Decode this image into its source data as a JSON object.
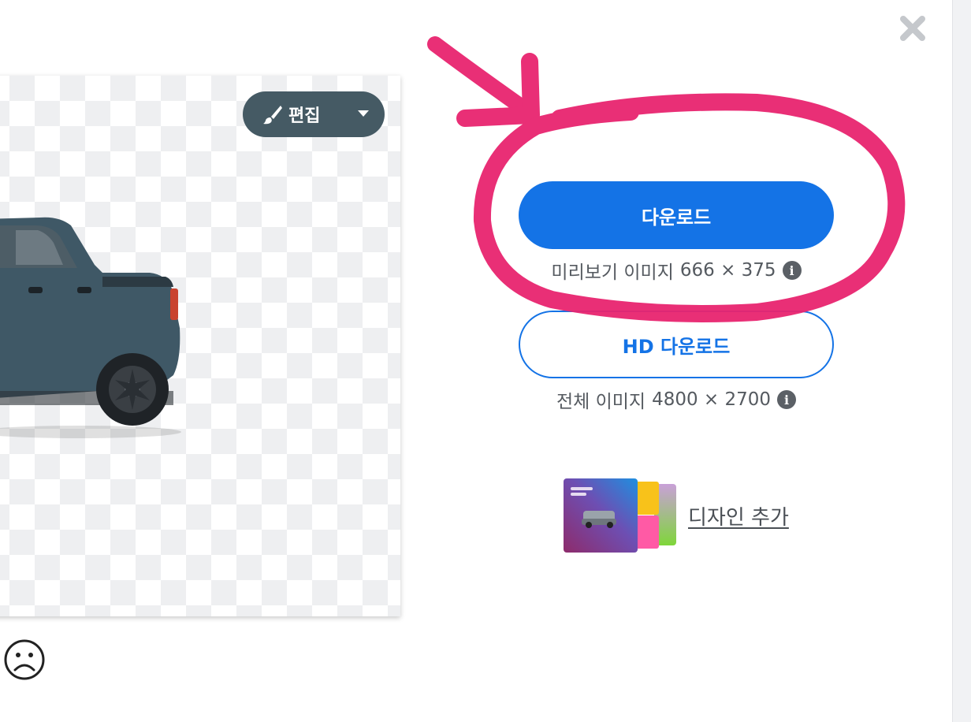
{
  "toolbar": {
    "edit_label": "편집"
  },
  "download": {
    "button_label": "다운로드",
    "preview_label": "미리보기 이미지",
    "preview_size": "666 × 375"
  },
  "hd_download": {
    "button_label": "HD 다운로드",
    "full_label": "전체 이미지",
    "full_size": "4800 × 2700"
  },
  "design": {
    "link_label": "디자인 추가"
  },
  "colors": {
    "primary_blue": "#1473e6",
    "edit_button_bg": "#455a64",
    "annotation_pink": "#e8246f"
  },
  "icons": [
    "close-icon",
    "brush-icon",
    "caret-down-icon",
    "info-icon",
    "sad-face-icon"
  ]
}
